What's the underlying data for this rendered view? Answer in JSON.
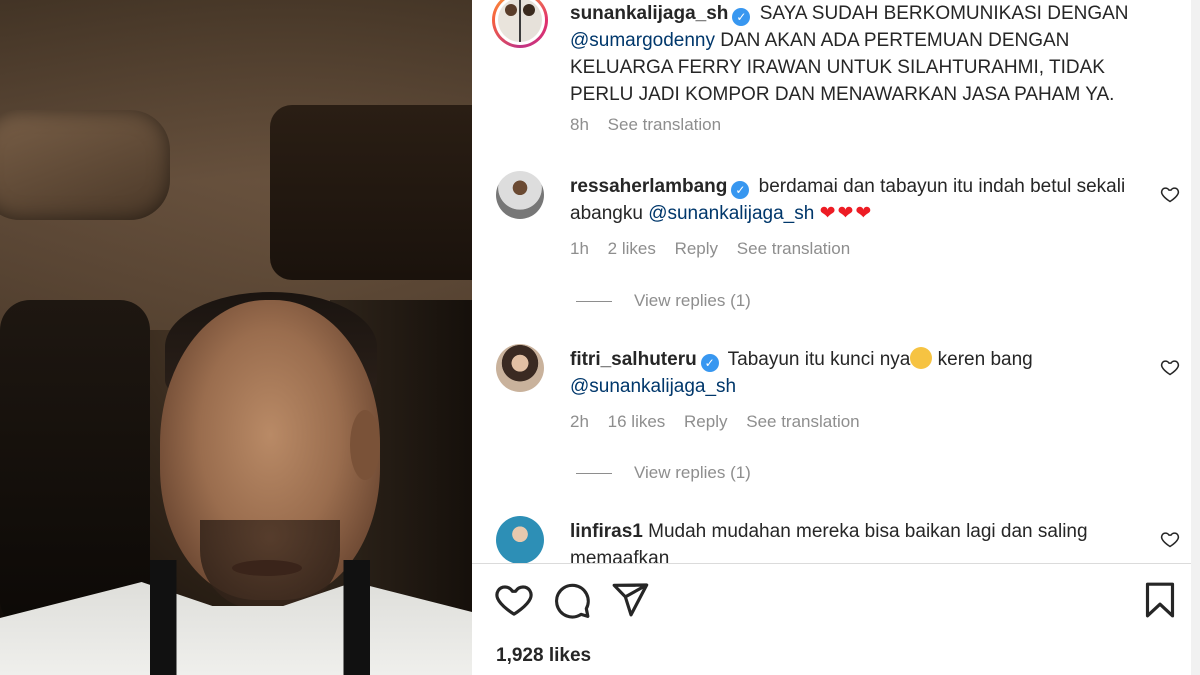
{
  "caption": {
    "username": "sunankalijaga_sh",
    "text_before": "SAYA SUDAH BERKOMUNIKASI DENGAN",
    "mention": "@sumargodenny",
    "text_after": " DAN AKAN ADA PERTEMUAN DENGAN KELUARGA FERRY IRAWAN UNTUK SILAHTURAHMI, TIDAK PERLU JADI KOMPOR DAN MENAWARKAN JASA PAHAM YA.",
    "time": "8h",
    "translate": "See translation"
  },
  "comments": [
    {
      "username": "ressaherlambang",
      "text": "berdamai dan tabayun itu indah betul sekali abangku ",
      "mention": "@sunankalijaga_sh",
      "hearts": "❤❤❤",
      "time": "1h",
      "likes": "2 likes",
      "reply": "Reply",
      "translate": "See translation",
      "view_replies": "View replies (1)"
    },
    {
      "username": "fitri_salhuteru",
      "text": "Tabayun itu kunci nya",
      "text_after": " keren bang ",
      "mention": "@sunankalijaga_sh",
      "time": "2h",
      "likes": "16 likes",
      "reply": "Reply",
      "translate": "See translation",
      "view_replies": "View replies (1)"
    },
    {
      "username": "linfiras1",
      "text": "Mudah mudahan mereka bisa baikan lagi dan saling memaafkan"
    }
  ],
  "footer": {
    "likes_count": "1,928 likes"
  },
  "icons": {
    "like": "heart-icon",
    "comment": "comment-icon",
    "share": "send-icon",
    "save": "bookmark-icon",
    "verified": "verified-badge-icon"
  },
  "colors": {
    "verified": "#3897f0",
    "mention": "#00376b",
    "meta": "#8e8e8e",
    "heart": "#ed1c24"
  }
}
